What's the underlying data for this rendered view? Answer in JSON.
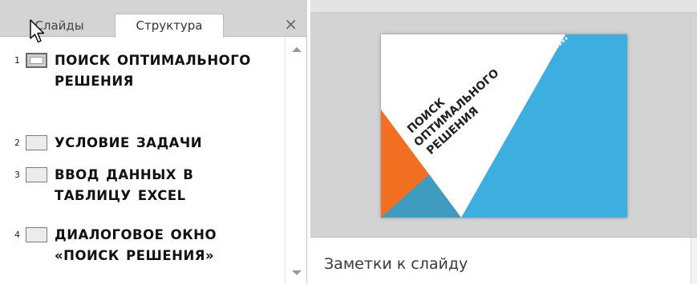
{
  "tabs": {
    "slides_label": "Слайды",
    "outline_label": "Структура",
    "close_symbol": "×"
  },
  "outline": [
    {
      "number": "1",
      "title": "ПОИСК ОПТИМАЛЬНОГО РЕШЕНИЯ",
      "selected": true
    },
    {
      "number": "2",
      "title": "УСЛОВИЕ ЗАДАЧИ",
      "selected": false
    },
    {
      "number": "3",
      "title": "ВВОД ДАННЫХ В ТАБЛИЦУ EXCEL",
      "selected": false
    },
    {
      "number": "4",
      "title": "ДИАЛОГОВОЕ ОКНО «ПОИСК РЕШЕНИЯ»",
      "selected": false
    }
  ],
  "slide": {
    "title_line1": "ПОИСК",
    "title_line2": "ОПТИМАЛЬНОГО",
    "title_line3": "РЕШЕНИЯ",
    "colors": {
      "blue": "#3eaee0",
      "orange": "#f26f21",
      "teal": "#3f9cc0"
    }
  },
  "notes": {
    "placeholder": "Заметки к слайду"
  }
}
